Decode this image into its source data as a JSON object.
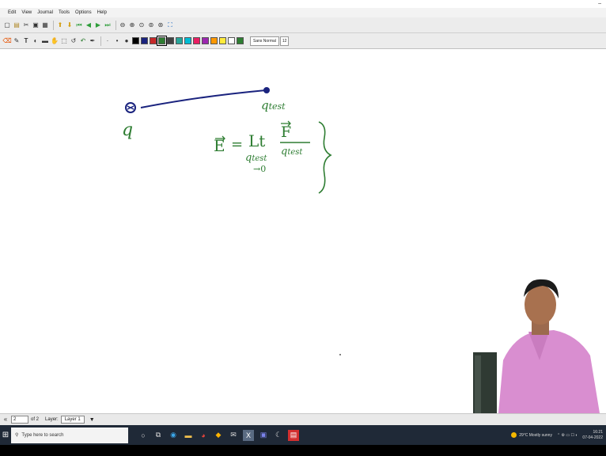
{
  "app": {
    "window_controls": "–"
  },
  "menu": [
    "Edit",
    "View",
    "Journal",
    "Tools",
    "Options",
    "Help"
  ],
  "toolbar1_icons": [
    "new-page-icon",
    "open-icon",
    "cut-icon",
    "save-icon",
    "clipboard-icon",
    "prev-page-icon",
    "next-page-icon",
    "first-page-icon",
    "previous-icon",
    "next-icon",
    "last-page-icon",
    "zoom-out-icon",
    "zoom-in-icon",
    "zoom-fit-icon",
    "zoom-page-icon",
    "zoom-width-icon",
    "fullscreen-icon"
  ],
  "toolbar2": {
    "tools": [
      "eraser-icon",
      "pen-icon",
      "text-icon",
      "shape-icon",
      "ruler-icon",
      "hand-icon",
      "select-icon",
      "recognizer-icon",
      "undo-icon",
      "redo-icon",
      "default-pen-icon"
    ],
    "colors": [
      "#000000",
      "#1a237e",
      "#c62828",
      "#2e7d32",
      "#424242",
      "#26a69a",
      "#00bcd4",
      "#e91e63",
      "#9c27b0",
      "#ff9800",
      "#ffeb3b",
      "#ffffff",
      "#2e7d32"
    ],
    "font": "Sans Normal",
    "font_size": "12"
  },
  "canvas": {
    "q_test_top": "q",
    "q_test_top_sub": "test",
    "charge_label": "q",
    "E_label": "E",
    "equals": "=",
    "lt": "Lt",
    "F_label": "F",
    "denom_q": "q",
    "denom_sub": "test",
    "limit_q": "q",
    "limit_sub": "test",
    "limit_arrow": "→0",
    "brace": "}"
  },
  "statusbar": {
    "page_value": "2",
    "page_of": "of 2",
    "layer_label": "Layer:",
    "layer_value": "Layer 1"
  },
  "taskbar": {
    "search_placeholder": "Type here to search",
    "weather": "29°C  Mostly sunny",
    "time": "16:21",
    "date": "07-04-2022"
  }
}
